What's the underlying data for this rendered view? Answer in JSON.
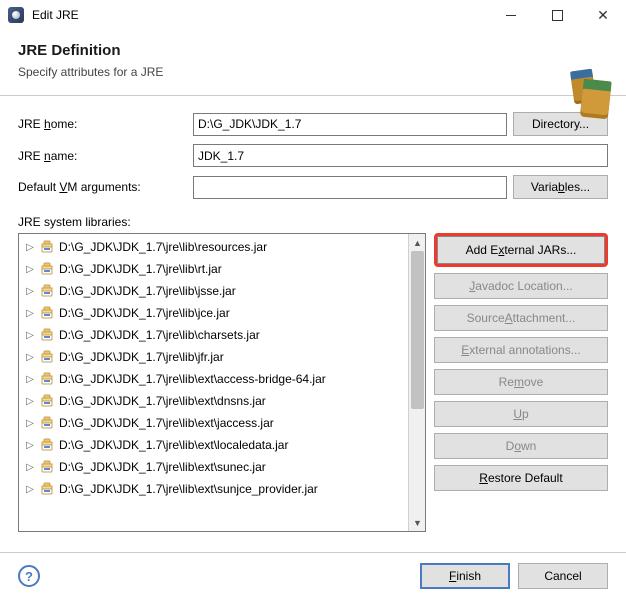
{
  "window": {
    "title": "Edit JRE"
  },
  "header": {
    "heading": "JRE Definition",
    "subheading": "Specify attributes for a JRE"
  },
  "form": {
    "jre_home_label_pre": "JRE ",
    "jre_home_label_u": "h",
    "jre_home_label_post": "ome:",
    "jre_home_value": "D:\\G_JDK\\JDK_1.7",
    "directory_btn": "Directory...",
    "jre_name_label_pre": "JRE ",
    "jre_name_label_u": "n",
    "jre_name_label_post": "ame:",
    "jre_name_value": "JDK_1.7",
    "default_vm_label_pre": "Default ",
    "default_vm_label_u": "V",
    "default_vm_label_post": "M arguments:",
    "default_vm_value": "",
    "variables_btn_pre": "Varia",
    "variables_btn_u": "b",
    "variables_btn_post": "les...",
    "libs_label": "JRE system libraries:"
  },
  "tree": {
    "items": [
      "D:\\G_JDK\\JDK_1.7\\jre\\lib\\resources.jar",
      "D:\\G_JDK\\JDK_1.7\\jre\\lib\\rt.jar",
      "D:\\G_JDK\\JDK_1.7\\jre\\lib\\jsse.jar",
      "D:\\G_JDK\\JDK_1.7\\jre\\lib\\jce.jar",
      "D:\\G_JDK\\JDK_1.7\\jre\\lib\\charsets.jar",
      "D:\\G_JDK\\JDK_1.7\\jre\\lib\\jfr.jar",
      "D:\\G_JDK\\JDK_1.7\\jre\\lib\\ext\\access-bridge-64.jar",
      "D:\\G_JDK\\JDK_1.7\\jre\\lib\\ext\\dnsns.jar",
      "D:\\G_JDK\\JDK_1.7\\jre\\lib\\ext\\jaccess.jar",
      "D:\\G_JDK\\JDK_1.7\\jre\\lib\\ext\\localedata.jar",
      "D:\\G_JDK\\JDK_1.7\\jre\\lib\\ext\\sunec.jar",
      "D:\\G_JDK\\JDK_1.7\\jre\\lib\\ext\\sunjce_provider.jar"
    ]
  },
  "side": {
    "add_external": {
      "pre": "Add E",
      "u": "x",
      "post": "ternal JARs..."
    },
    "javadoc": {
      "pre": "",
      "u": "J",
      "post": "avadoc Location..."
    },
    "source": {
      "pre": "Source ",
      "u": "A",
      "post": "ttachment..."
    },
    "ext_ann": {
      "pre": "",
      "u": "E",
      "post": "xternal annotations..."
    },
    "remove": {
      "pre": "Re",
      "u": "m",
      "post": "ove"
    },
    "up": {
      "pre": "",
      "u": "U",
      "post": "p"
    },
    "down": {
      "pre": "D",
      "u": "o",
      "post": "wn"
    },
    "restore": {
      "pre": "",
      "u": "R",
      "post": "estore Default"
    }
  },
  "footer": {
    "finish_pre": "",
    "finish_u": "F",
    "finish_post": "inish",
    "cancel": "Cancel"
  }
}
